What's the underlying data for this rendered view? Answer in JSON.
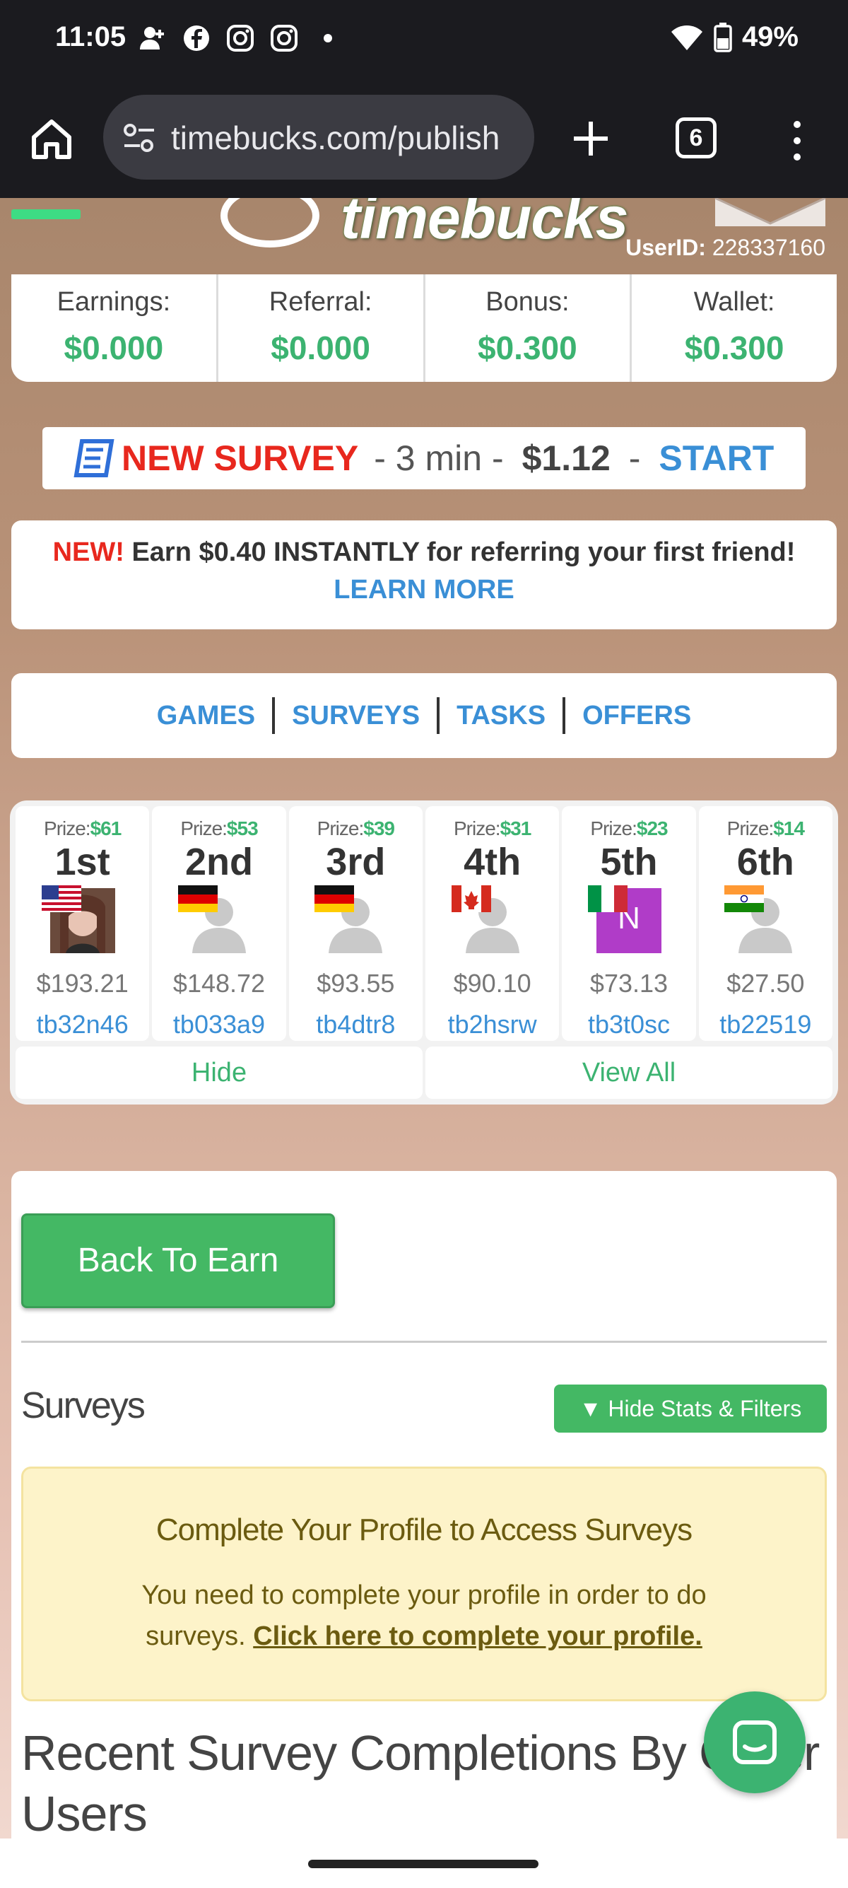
{
  "status_bar": {
    "time": "11:05",
    "battery": "49%",
    "notification_icons": [
      "person-add-icon",
      "facebook-icon",
      "instagram-icon",
      "instagram-icon",
      "dot-icon"
    ]
  },
  "browser": {
    "url": "timebucks.com/publish",
    "tab_count": "6"
  },
  "header": {
    "logo_text": "timebucks",
    "userid_label": "UserID:",
    "userid_value": "228337160"
  },
  "stats": [
    {
      "label": "Earnings:",
      "value": "$0.000"
    },
    {
      "label": "Referral:",
      "value": "$0.000"
    },
    {
      "label": "Bonus:",
      "value": "$0.300"
    },
    {
      "label": "Wallet:",
      "value": "$0.300"
    }
  ],
  "survey_banner": {
    "new_survey": "NEW SURVEY",
    "duration": "- 3 min -",
    "price": "$1.12",
    "dash": "-",
    "start": "START"
  },
  "referral": {
    "new": "NEW!",
    "text": "Earn $0.40 INSTANTLY for referring your first friend!",
    "link": "LEARN MORE"
  },
  "nav_links": [
    "GAMES",
    "SURVEYS",
    "TASKS",
    "OFFERS"
  ],
  "leaderboard": {
    "prize_label": "Prize:",
    "entries": [
      {
        "prize": "$61",
        "rank": "1st",
        "flag": "us",
        "amount": "$193.21",
        "user": "tb32n46",
        "avatar": "photo"
      },
      {
        "prize": "$53",
        "rank": "2nd",
        "flag": "de",
        "amount": "$148.72",
        "user": "tb033a9",
        "avatar": "default"
      },
      {
        "prize": "$39",
        "rank": "3rd",
        "flag": "de",
        "amount": "$93.55",
        "user": "tb4dtr8",
        "avatar": "default"
      },
      {
        "prize": "$31",
        "rank": "4th",
        "flag": "ca",
        "amount": "$90.10",
        "user": "tb2hsrw",
        "avatar": "default"
      },
      {
        "prize": "$23",
        "rank": "5th",
        "flag": "it",
        "amount": "$73.13",
        "user": "tb3t0sc",
        "avatar": "letter",
        "letter": "N"
      },
      {
        "prize": "$14",
        "rank": "6th",
        "flag": "in",
        "amount": "$27.50",
        "user": "tb22519",
        "avatar": "default"
      }
    ],
    "hide_label": "Hide",
    "view_all_label": "View All"
  },
  "content": {
    "back_button": "Back To Earn",
    "surveys_title": "Surveys",
    "filters_button": "▼  Hide Stats & Filters",
    "profile_title": "Complete Your Profile to Access Surveys",
    "profile_text": "You need to complete your profile in order to do surveys.",
    "profile_link": "Click here to complete your profile.",
    "recent_title": "Recent Survey Completions By Other Users"
  },
  "colors": {
    "accent_green": "#3cb371",
    "link_blue": "#3a8fd6",
    "alert_red": "#e8281e",
    "notice_bg": "#fdf3c9"
  }
}
